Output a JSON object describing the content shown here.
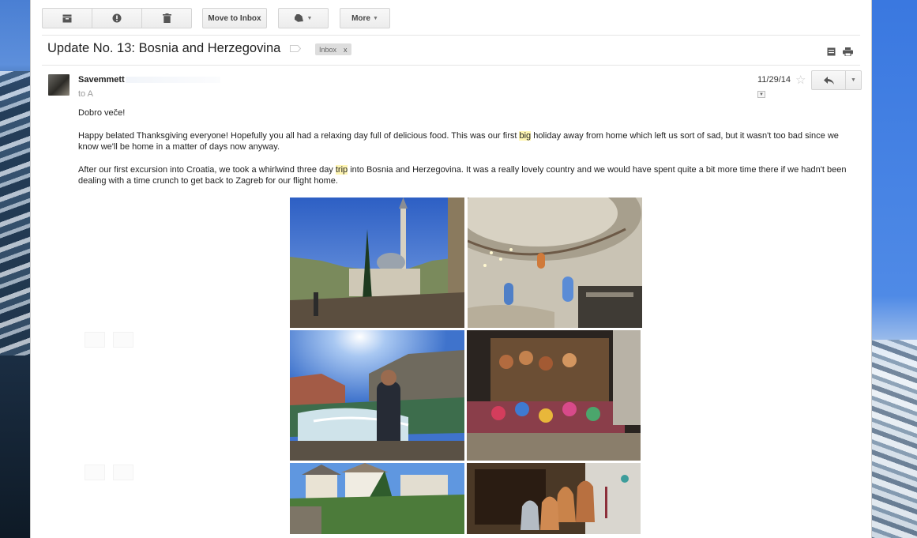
{
  "toolbar": {
    "archive_icon": "archive-icon",
    "spam_icon": "report-spam-icon",
    "delete_icon": "trash-icon",
    "move_to_inbox_label": "Move to Inbox",
    "labels_icon": "label-tag-icon",
    "more_label": "More"
  },
  "message": {
    "subject": "Update No. 13: Bosnia and Herzegovina",
    "label_chip": "Inbox",
    "label_chip_remove": "x",
    "sender": "Savemmett",
    "to": "to A",
    "date": "11/29/14",
    "greeting": "Dobro veče!",
    "para1_a": "Happy belated Thanksgiving everyone! Hopefully you all had a relaxing day full of delicious food. This was our first ",
    "para1_hl": "big",
    "para1_b": " holiday away from home which left us sort of sad, but it wasn't too bad since we know we'll be home in a matter of days now anyway.",
    "para2_a": "After our first excursion into Croatia, we took a whirlwind three day ",
    "para2_hl": "trip",
    "para2_b": " into Bosnia and Herzegovina. It was a really lovely country and we would have spent quite a bit more time there if we hadn't been dealing with a time crunch to get back to Zagreb for our flight home."
  },
  "photos": [
    {
      "subject": "mosque-and-minaret-street"
    },
    {
      "subject": "mosque-interior-dome"
    },
    {
      "subject": "river-and-old-bridge-portrait"
    },
    {
      "subject": "souvenir-market-stall"
    },
    {
      "subject": "old-town-rooftops"
    },
    {
      "subject": "copper-coffee-pots-shop"
    }
  ]
}
